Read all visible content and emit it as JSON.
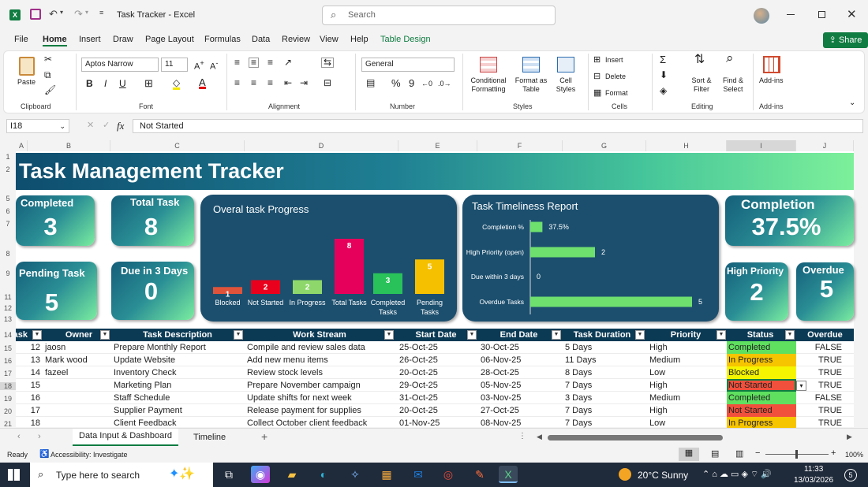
{
  "window": {
    "title": "Task Tracker  -  Excel",
    "search_placeholder": "Search"
  },
  "menu": [
    "File",
    "Home",
    "Insert",
    "Draw",
    "Page Layout",
    "Formulas",
    "Data",
    "Review",
    "View",
    "Help",
    "Table Design"
  ],
  "share_label": "Share",
  "ribbon": {
    "clipboard": {
      "paste": "Paste",
      "label": "Clipboard"
    },
    "font": {
      "name": "Aptos Narrow",
      "size": "11",
      "bold": "B",
      "italic": "I",
      "underline": "U",
      "label": "Font"
    },
    "alignment": {
      "label": "Alignment"
    },
    "number": {
      "format": "General",
      "percent": "%",
      "comma": "9",
      "label": "Number"
    },
    "styles": {
      "conditional": "Conditional Formatting",
      "format_table": "Format as Table",
      "cell_styles": "Cell Styles",
      "label": "Styles"
    },
    "cells": {
      "insert": "Insert",
      "delete": "Delete",
      "format": "Format",
      "label": "Cells"
    },
    "editing": {
      "sort": "Sort & Filter",
      "find": "Find & Select",
      "label": "Editing"
    },
    "addins": {
      "addins": "Add-ins",
      "label": "Add-ins"
    }
  },
  "formula_bar": {
    "cell_ref": "I18",
    "fx": "fx",
    "value": "Not Started"
  },
  "columns": [
    "A",
    "B",
    "C",
    "D",
    "E",
    "F",
    "G",
    "H",
    "I",
    "J"
  ],
  "rows": [
    "1",
    "2",
    "5",
    "6",
    "7",
    "8",
    "9",
    "11",
    "12",
    "13",
    "14",
    "15",
    "16",
    "17",
    "18",
    "19",
    "20",
    "21"
  ],
  "dashboard": {
    "title": "Task Management Tracker",
    "cards": [
      {
        "label": "Completed",
        "value": "3"
      },
      {
        "label": "Total Task",
        "value": "8"
      },
      {
        "label": "Pending Task",
        "value": "5"
      },
      {
        "label": "Due in 3 Days",
        "value": "0"
      },
      {
        "label": "Completion",
        "value": "37.5%"
      },
      {
        "label": "High Priority",
        "value": "2"
      },
      {
        "label": "Overdue",
        "value": "5"
      }
    ]
  },
  "chart_data": [
    {
      "type": "bar",
      "title": "Overal task Progress",
      "categories": [
        "Blocked",
        "Not Started",
        "In Progress",
        "Total Tasks",
        "Completed Tasks",
        "Pending Tasks"
      ],
      "values": [
        1,
        2,
        2,
        8,
        3,
        5
      ],
      "colors": [
        "#e0533b",
        "#e8001c",
        "#8ed86b",
        "#e6005c",
        "#29c25a",
        "#f5c000"
      ]
    },
    {
      "type": "bar",
      "orientation": "horizontal",
      "title": "Task Timeliness Report",
      "categories": [
        "Completion %",
        "High Priority (open)",
        "Due within 3 days",
        "Overdue Tasks"
      ],
      "values": [
        0.375,
        2,
        0,
        5
      ],
      "value_labels": [
        "37.5%",
        "2",
        "0",
        "5"
      ],
      "color": "#6ee06e"
    }
  ],
  "table": {
    "headers": [
      "Task ID",
      "Owner",
      "Task Description",
      "Work Stream",
      "Start Date",
      "End Date",
      "Task Duration",
      "Priority",
      "Status",
      "Overdue"
    ],
    "rows": [
      {
        "id": "12",
        "owner": "jaosn",
        "desc": "Prepare Monthly Report",
        "stream": "Compile and review sales data",
        "start": "25-Oct-25",
        "end": "30-Oct-25",
        "dur": "5 Days",
        "prio": "High",
        "status": "Completed",
        "overdue": "FALSE"
      },
      {
        "id": "13",
        "owner": "Mark wood",
        "desc": "Update Website",
        "stream": "Add new menu items",
        "start": "26-Oct-25",
        "end": "06-Nov-25",
        "dur": "11 Days",
        "prio": "Medium",
        "status": "In Progress",
        "overdue": "TRUE"
      },
      {
        "id": "14",
        "owner": "fazeel",
        "desc": "Inventory Check",
        "stream": "Review stock levels",
        "start": "20-Oct-25",
        "end": "28-Oct-25",
        "dur": "8 Days",
        "prio": "Low",
        "status": "Blocked",
        "overdue": "TRUE"
      },
      {
        "id": "15",
        "owner": "",
        "desc": "Marketing Plan",
        "stream": "Prepare November campaign",
        "start": "29-Oct-25",
        "end": "05-Nov-25",
        "dur": "7 Days",
        "prio": "High",
        "status": "Not Started",
        "overdue": "TRUE"
      },
      {
        "id": "16",
        "owner": "",
        "desc": "Staff Schedule",
        "stream": "Update shifts for next week",
        "start": "31-Oct-25",
        "end": "03-Nov-25",
        "dur": "3 Days",
        "prio": "Medium",
        "status": "Completed",
        "overdue": "FALSE"
      },
      {
        "id": "17",
        "owner": "",
        "desc": "Supplier Payment",
        "stream": "Release payment for supplies",
        "start": "20-Oct-25",
        "end": "27-Oct-25",
        "dur": "7 Days",
        "prio": "High",
        "status": "Not Started",
        "overdue": "TRUE"
      },
      {
        "id": "18",
        "owner": "",
        "desc": "Client Feedback",
        "stream": "Collect October client feedback",
        "start": "01-Nov-25",
        "end": "08-Nov-25",
        "dur": "7 Days",
        "prio": "Low",
        "status": "In Progress",
        "overdue": "TRUE"
      }
    ],
    "status_colors": {
      "Completed": "#5fe05f",
      "In Progress": "#f7c400",
      "Blocked": "#f5f500",
      "Not Started": "#f0503c"
    }
  },
  "sheet_tabs": [
    "Data Input & Dashboard",
    "Timeline"
  ],
  "status": {
    "ready": "Ready",
    "accessibility": "Accessibility: Investigate",
    "zoom": "100%"
  },
  "taskbar": {
    "search": "Type here to search",
    "weather": "20°C  Sunny",
    "time": "11:33",
    "date": "13/03/2026",
    "notif": "5"
  }
}
